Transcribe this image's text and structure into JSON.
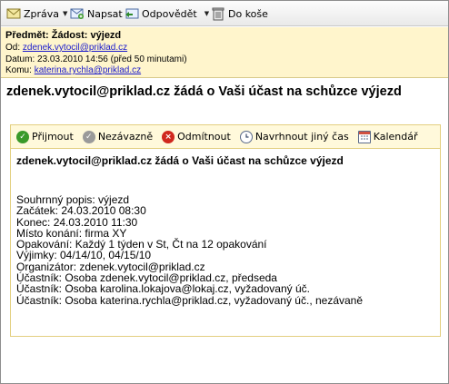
{
  "toolbar": {
    "reply_label": "Zpráva",
    "write_label": "Napsat",
    "respond_label": "Odpovědět",
    "trash_label": "Do koše"
  },
  "header": {
    "subject_label": "Předmět:",
    "subject": "Žádost: výjezd",
    "from_label": "Od:",
    "from": "zdenek.vytocil@priklad.cz",
    "date_label": "Datum:",
    "date": "23.03.2010 14:56 (před 50 minutami)",
    "to_label": "Komu:",
    "to": "katerina.rychla@priklad.cz"
  },
  "message_title": "zdenek.vytocil@priklad.cz žádá o Vaši účast na schůzce výjezd",
  "invite": {
    "actions": {
      "accept": "Přijmout",
      "tentative": "Nezávazně",
      "decline": "Odmítnout",
      "propose": "Navrhnout jiný čas",
      "calendar": "Kalendář"
    },
    "title": "zdenek.vytocil@priklad.cz žádá o Vaši účast na schůzce výjezd",
    "lines": [
      "Souhrnný popis: výjezd",
      "Začátek: 24.03.2010 08:30",
      "Konec: 24.03.2010 11:30",
      "Místo konání: firma XY",
      "Opakování: Každý 1 týden v St, Čt na 12 opakování",
      "Výjimky: 04/14/10, 04/15/10",
      "Organizátor: zdenek.vytocil@priklad.cz",
      "Účastník: Osoba zdenek.vytocil@priklad.cz, předseda",
      "Účastník: Osoba karolina.lokajova@lokaj.cz, vyžadovaný úč.",
      "Účastník: Osoba katerina.rychla@priklad.cz, vyžadovaný úč., nezávaně"
    ]
  },
  "colors": {
    "header_bg": "#fff5cc",
    "actions_bg": "#fff9db",
    "accept_green": "#3a9a2a",
    "decline_red": "#d0281e",
    "link_blue": "#1a1acc"
  },
  "icons": [
    "message-icon",
    "compose-icon",
    "reply-icon",
    "trash-icon",
    "check-icon",
    "question-icon",
    "x-icon",
    "clock-icon",
    "calendar-icon"
  ]
}
